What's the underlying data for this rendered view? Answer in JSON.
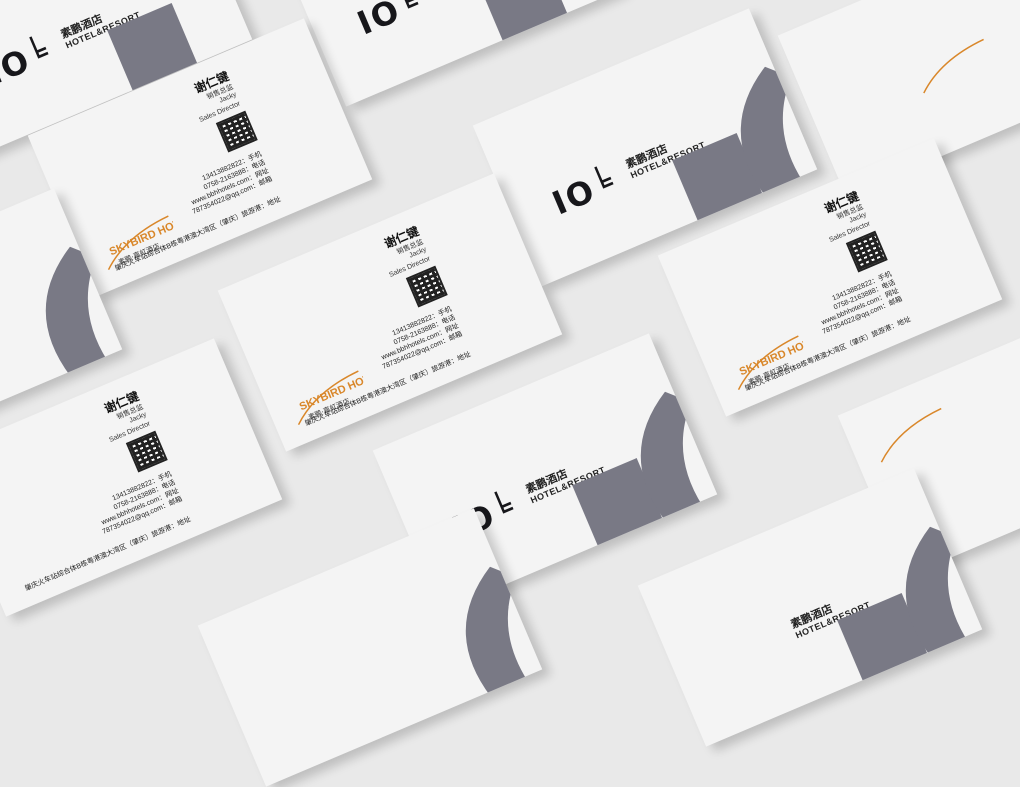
{
  "front": {
    "logo_mark": "IO╘",
    "brand_cn": "素鹏酒店",
    "brand_en": "HOTEL&RESORT"
  },
  "back": {
    "logo_en": "SKYBIRD HOTEL",
    "logo_cn": "素鹏·嘉虹酒店",
    "name": "谢仁键",
    "role_cn": "销售总监",
    "nickname": "Jacky",
    "title_en": "Sales Director",
    "phone": "13413882822：手机",
    "tel": "0758-2163888：电话",
    "web": "www.bbhhotels.com：网址",
    "email": "787354022@qq.com：邮箱",
    "address": "肇庆火车站综合体B栋粤港澳大湾区（肇庆）旅游港：地址"
  },
  "colors": {
    "accent": "#d9872a",
    "block": "#797985",
    "background": "#e9e9e9",
    "card": "#f4f4f4"
  }
}
